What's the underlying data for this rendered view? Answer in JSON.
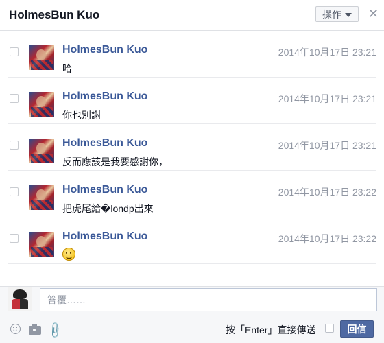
{
  "header": {
    "title": "HolmesBun Kuo",
    "action_label": "操作",
    "close_label": "✕"
  },
  "messages": [
    {
      "sender": "HolmesBun Kuo",
      "time": "2014年10月17日 23:21",
      "text": "哈"
    },
    {
      "sender": "HolmesBun Kuo",
      "time": "2014年10月17日 23:21",
      "text": "你也別謝"
    },
    {
      "sender": "HolmesBun Kuo",
      "time": "2014年10月17日 23:21",
      "text": "反而應該是我要感謝你，"
    },
    {
      "sender": "HolmesBun Kuo",
      "time": "2014年10月17日 23:22",
      "text": "把虎尾給�londp出來"
    },
    {
      "sender": "HolmesBun Kuo",
      "time": "2014年10月17日 23:22",
      "text": "",
      "emoji": "smiley-icon"
    }
  ],
  "footer": {
    "reply_placeholder": "答覆……",
    "enter_label": "按「Enter」直接傳送",
    "reply_button": "回信"
  },
  "icons": [
    "chevron-down-icon",
    "close-icon",
    "checkbox-icon",
    "emoji-icon",
    "camera-icon",
    "paperclip-icon"
  ],
  "colors": {
    "link": "#3b5998",
    "button": "#4e69a2",
    "muted": "#9197a3"
  }
}
